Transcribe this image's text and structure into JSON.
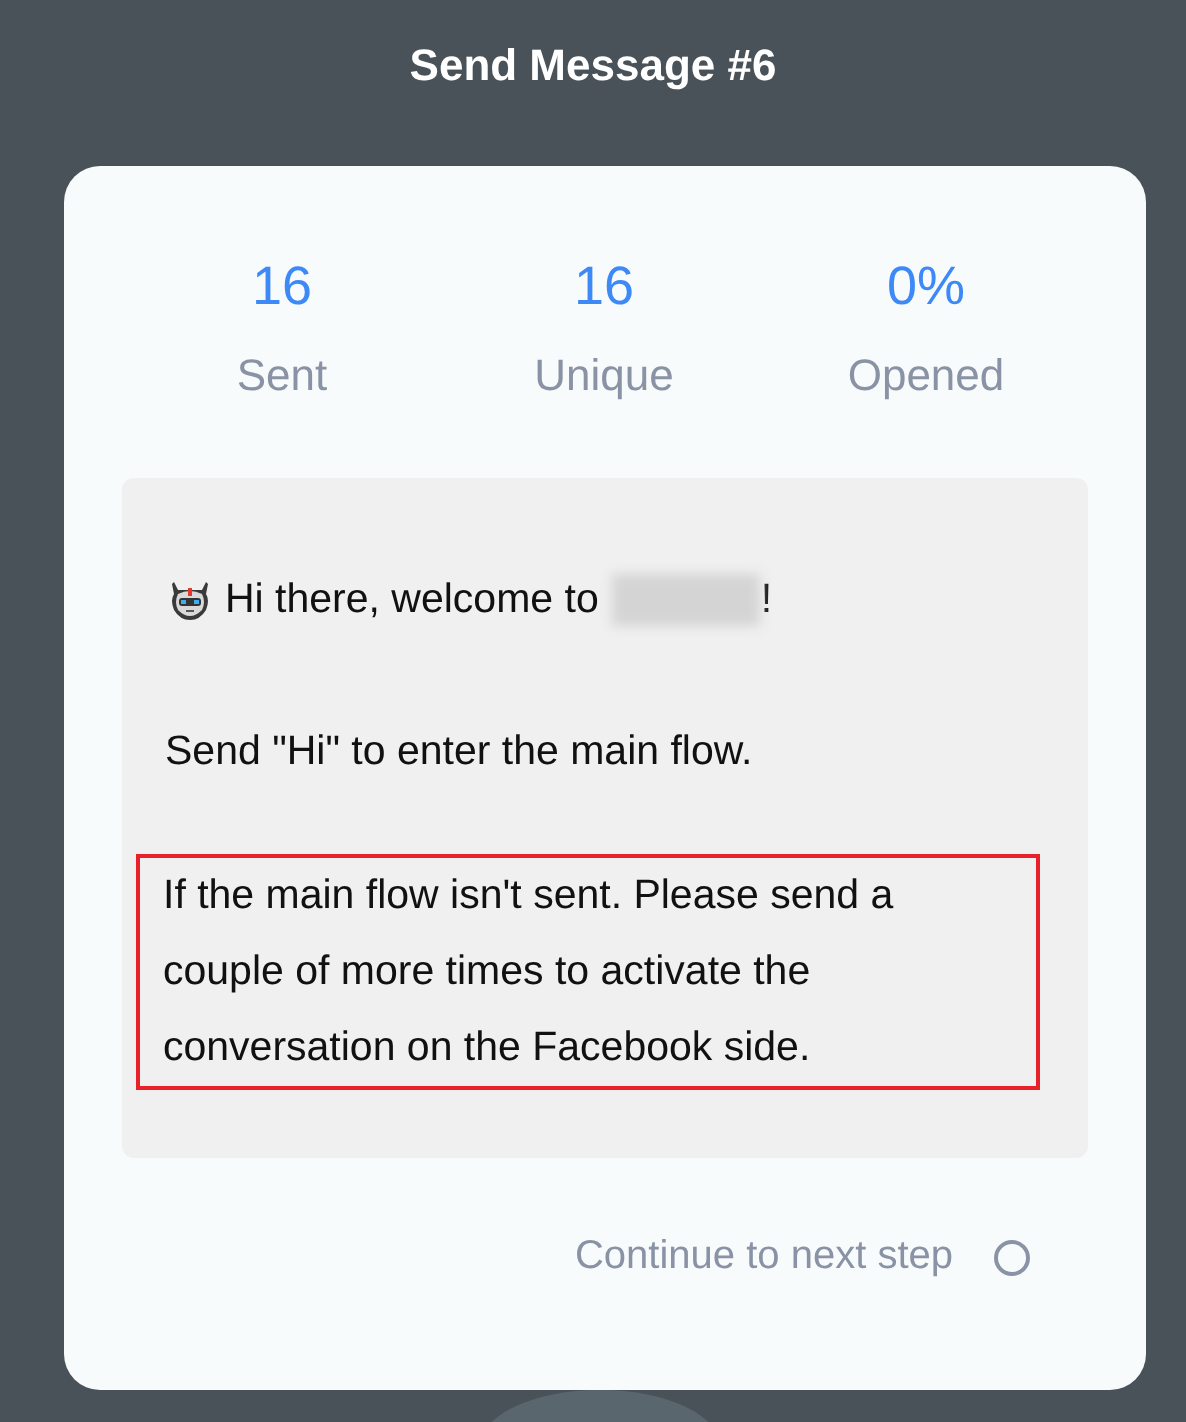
{
  "title": "Send Message #6",
  "stats": [
    {
      "value": "16",
      "label": "Sent"
    },
    {
      "value": "16",
      "label": "Unique"
    },
    {
      "value": "0%",
      "label": "Opened"
    }
  ],
  "message": [
    {
      "kind": "greeting",
      "text": "Hi there, welcome to",
      "suffix": "!"
    },
    {
      "kind": "plain",
      "text": "Send \"Hi\" to enter the main flow."
    },
    {
      "kind": "highlighted",
      "text": "If the main flow isn't sent. Please send a couple of more times to activate the conversation on the Facebook side."
    }
  ],
  "continue": {
    "label": "Continue to next step",
    "checked": false
  }
}
